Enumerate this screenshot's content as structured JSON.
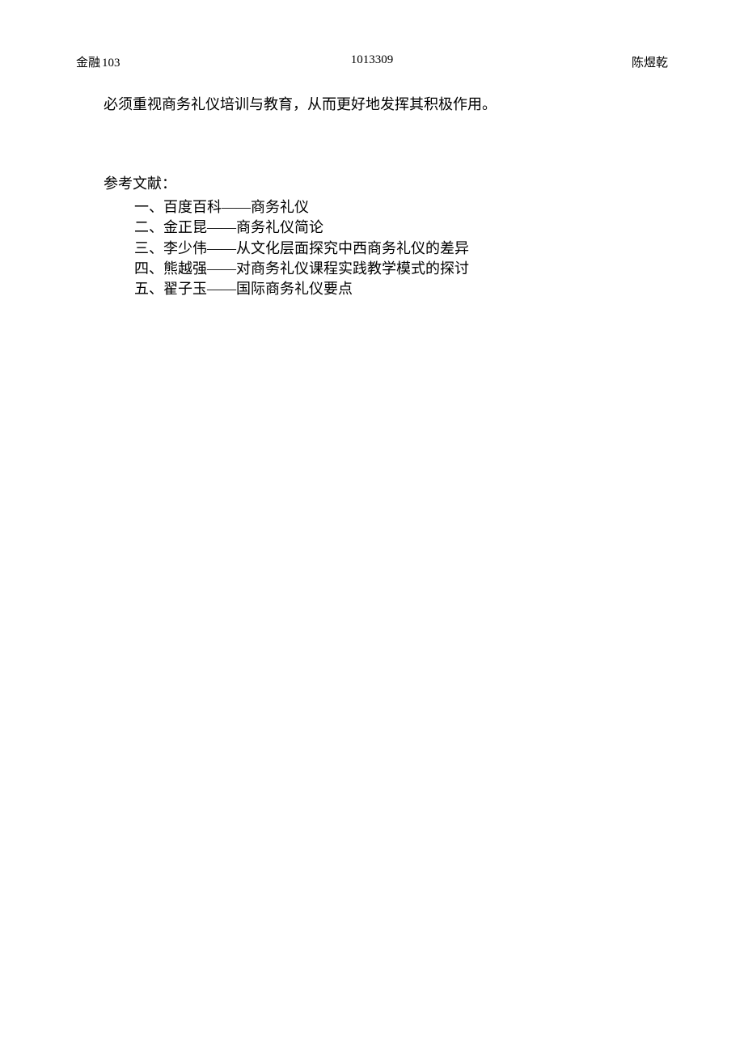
{
  "header": {
    "left_cn": "金融",
    "left_num": "103",
    "center": "1013309",
    "right": "陈煜乾"
  },
  "body": {
    "paragraph": "必须重视商务礼仪培训与教育，从而更好地发挥其积极作用。"
  },
  "references": {
    "heading": "参考文献：",
    "items": [
      "一、百度百科——商务礼仪",
      "二、金正昆——商务礼仪简论",
      "三、李少伟——从文化层面探究中西商务礼仪的差异",
      "四、熊越强——对商务礼仪课程实践教学模式的探讨",
      "五、翟子玉——国际商务礼仪要点"
    ]
  }
}
